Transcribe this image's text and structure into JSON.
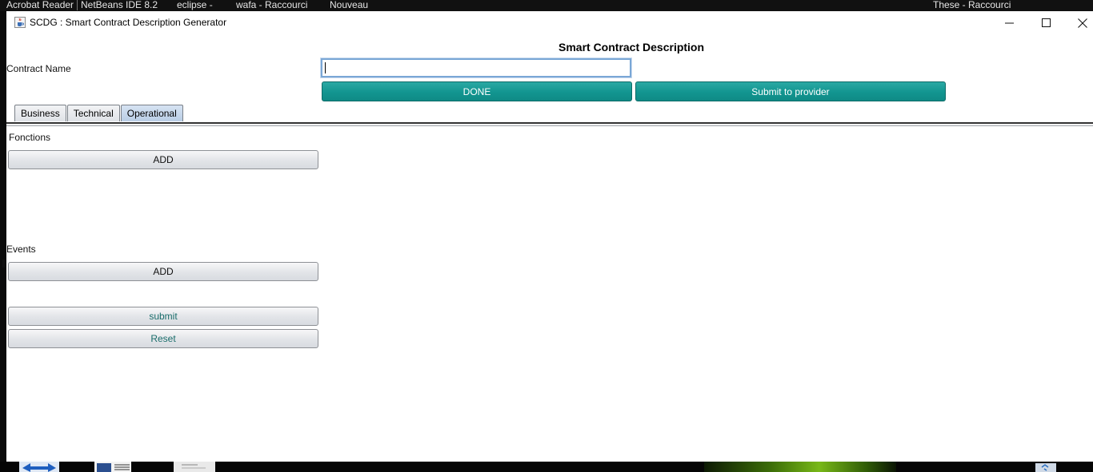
{
  "desktop": {
    "taskbar_labels": [
      "Acrobat Reader",
      "NetBeans IDE 8.2",
      "eclipse -",
      "wafa - Raccourci",
      "Nouveau",
      "These - Raccourci"
    ]
  },
  "window": {
    "title": "SCDG : Smart Contract Description Generator",
    "icon": "java-cup-icon",
    "controls": {
      "minimize": "—",
      "maximize": "☐",
      "close": "✕"
    }
  },
  "form": {
    "heading": "Smart Contract Description",
    "contract_name_label": "Contract Name",
    "contract_name_value": "",
    "done_label": "DONE",
    "submit_provider_label": "Submit to provider"
  },
  "tabs": [
    {
      "label": "Business",
      "active": false
    },
    {
      "label": "Technical",
      "active": false
    },
    {
      "label": "Operational",
      "active": true
    }
  ],
  "operational": {
    "functions_label": "Fonctions",
    "functions_add_label": "ADD",
    "events_label": "Events",
    "events_add_label": "ADD",
    "submit_label": "submit",
    "reset_label": "Reset"
  },
  "colors": {
    "accent_teal": "#129590",
    "text_teal": "#1a6d6b",
    "tab_active": "#b9cde5"
  }
}
